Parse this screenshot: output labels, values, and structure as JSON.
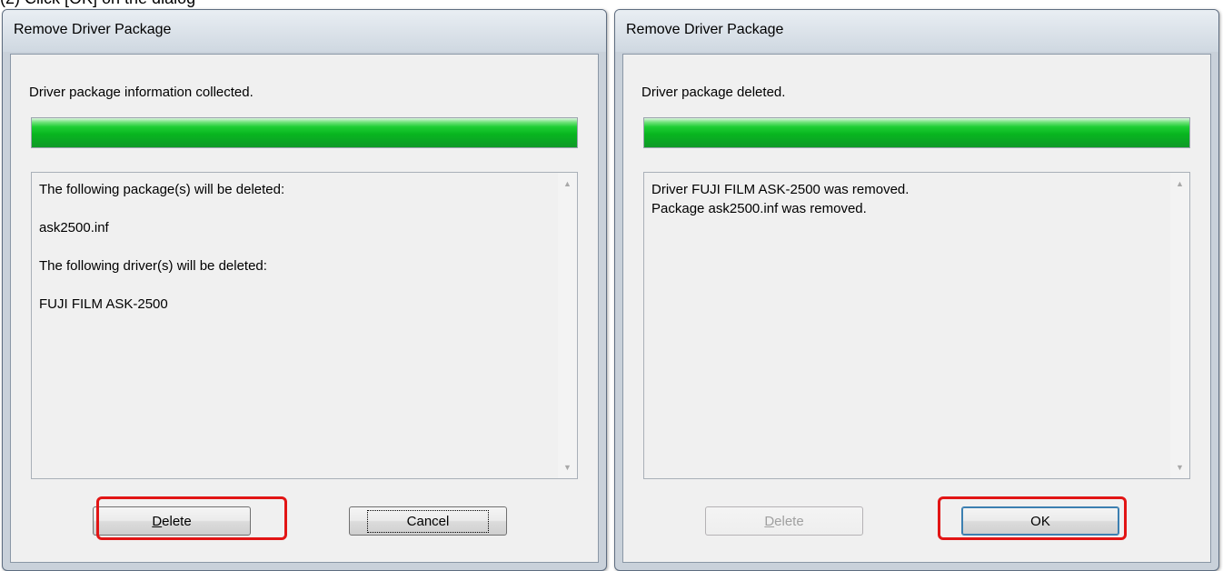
{
  "caption": "(2) Click [OK] on the dialog",
  "dialogs": [
    {
      "title": "Remove Driver Package",
      "status_text": "Driver package information collected.",
      "progress": 1.0,
      "details": [
        "The following package(s) will be deleted:",
        "ask2500.inf",
        "The following driver(s) will be deleted:",
        "FUJI FILM ASK-2500"
      ],
      "buttons": {
        "delete": {
          "mnemonic": "D",
          "rest": "elete",
          "state": "enabled",
          "highlighted": true
        },
        "cancel": {
          "label": "Cancel",
          "state": "focused",
          "highlighted": false
        }
      }
    },
    {
      "title": "Remove Driver Package",
      "status_text": "Driver package deleted.",
      "progress": 1.0,
      "details": [
        "Driver FUJI FILM ASK-2500 was removed.",
        "Package ask2500.inf was removed."
      ],
      "buttons": {
        "delete": {
          "mnemonic": "D",
          "rest": "elete",
          "state": "disabled",
          "highlighted": false
        },
        "ok": {
          "label": "OK",
          "state": "default",
          "highlighted": true
        }
      }
    }
  ],
  "colors": {
    "highlight": "#e21515",
    "progress_green": "#1dce33"
  },
  "icons": {
    "scroll_up": "scroll-up-arrow-icon",
    "scroll_down": "scroll-down-arrow-icon"
  }
}
